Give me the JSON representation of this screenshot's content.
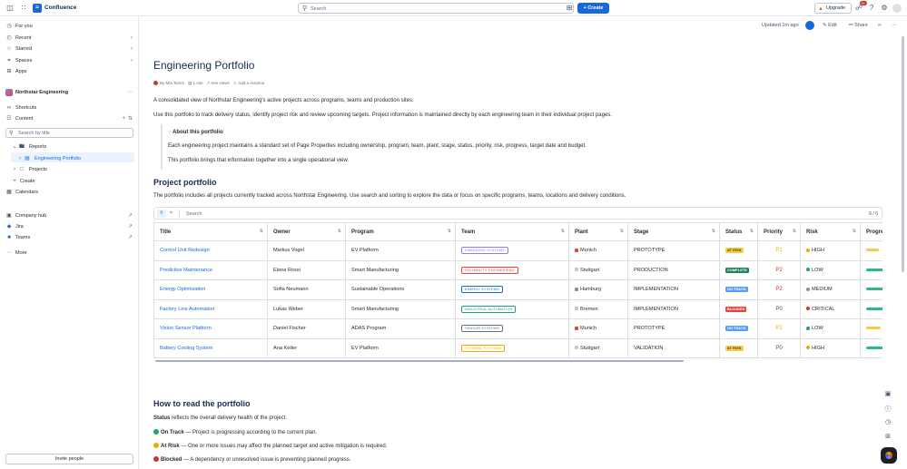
{
  "topbar": {
    "brand": "Confluence",
    "search_placeholder": "Search",
    "create_label": "Create",
    "upgrade_label": "Upgrade",
    "notif_count": "9+"
  },
  "sidebar": {
    "top_items": [
      {
        "label": "For you",
        "icon": "clock-icon"
      },
      {
        "label": "Recent",
        "icon": "recent-icon"
      },
      {
        "label": "Starred",
        "icon": "star-icon"
      },
      {
        "label": "Spaces",
        "icon": "spaces-icon"
      },
      {
        "label": "Apps",
        "icon": "apps-icon"
      }
    ],
    "space_name": "Northstar Engineering",
    "shortcuts_label": "Shortcuts",
    "content_label": "Content",
    "search_placeholder": "Search by title",
    "tree": [
      {
        "label": "Reports"
      },
      {
        "label": "Engineering Portfolio"
      },
      {
        "label": "Projects"
      },
      {
        "label": "Create"
      }
    ],
    "calendars_label": "Calendars",
    "links": [
      {
        "label": "Company hub"
      },
      {
        "label": "Jira"
      },
      {
        "label": "Teams"
      }
    ],
    "more_label": "More",
    "invite_label": "Invite people"
  },
  "page_tools": {
    "updated": "Updated 1m ago",
    "edit": "Edit",
    "share": "Share"
  },
  "page": {
    "title": "Engineering Portfolio",
    "author": "By Mia Tamm",
    "read_time": "1 min",
    "see_views": "See views",
    "add_reaction": "Add a reaction",
    "intro1": "A consolidated view of Northstar Engineering's active projects across programs, teams and production sites.",
    "intro2": "Use this portfolio to track delivery status, identify project risk and review upcoming targets. Project information is maintained directly by each engineering team in their individual project pages.",
    "callout_title": "About this portfolio",
    "callout_p1": "Each engineering project maintains a standard set of Page Properties including ownership, program, team, plant, stage, status, priority, risk, progress, target date and budget.",
    "callout_p2": "This portfolio brings that information together into a single operational view.",
    "section_title": "Project portfolio",
    "section_desc": "The portfolio includes all projects currently tracked across Northstar Engineering. Use search and sorting to explore the data or focus on specific programs, teams, locations and delivery conditions.",
    "table_search_placeholder": "Search",
    "table_count": "6 / 6",
    "how_title": "How to read the portfolio",
    "status_intro_bold": "Status",
    "status_intro_rest": " reflects the overall delivery health of the project.",
    "legend": [
      {
        "bold": "On Track",
        "rest": " — Project is progressing according to the current plan.",
        "color": "#22a06b"
      },
      {
        "bold": "At Risk",
        "rest": " — One or more issues may affect the planned target and active mitigation is required.",
        "color": "#e2b203"
      },
      {
        "bold": "Blocked",
        "rest": " — A dependency or unresolved issue is preventing planned progress.",
        "color": "#c9372c"
      }
    ]
  },
  "table": {
    "columns": [
      "Title",
      "Owner",
      "Program",
      "Team",
      "Plant",
      "Stage",
      "Status",
      "Priority",
      "Risk",
      "Progress"
    ],
    "rows": [
      {
        "title": "Control Unit Redesign",
        "owner": "Markus Vogel",
        "program": "EV Platform",
        "team": "EMBEDDED SYSTEMS",
        "team_color": "#8f7ee7",
        "plant": "Munich",
        "plant_color": "#e2483d",
        "stage": "PROTOTYPE",
        "status": "AT RISK",
        "status_bg": "#f5cd47",
        "status_fg": "#533f04",
        "priority": "P1",
        "prio_color": "#e2b203",
        "risk": "HIGH",
        "risk_color": "#e2b203",
        "progress": 0.6,
        "progress_color": "#f5cd47"
      },
      {
        "title": "Predictive Maintenance",
        "owner": "Elena Rossi",
        "program": "Smart Manufacturing",
        "team": "RELIABILITY ENGINEERING",
        "team_color": "#e2483d",
        "plant": "Stuttgart",
        "plant_color": "#c1c7d0",
        "stage": "PRODUCTION",
        "status": "COMPLETE",
        "status_bg": "#1f845a",
        "status_fg": "#ffffff",
        "priority": "P2",
        "prio_color": "#c9372c",
        "risk": "LOW",
        "risk_color": "#22a06b",
        "progress": 1.0,
        "progress_color": "#2abb7f"
      },
      {
        "title": "Energy Optimization",
        "owner": "Sofia Neumann",
        "program": "Sustainable Operations",
        "team": "ENERGY SYSTEMS",
        "team_color": "#1868db",
        "plant": "Hamburg",
        "plant_color": "#8590a2",
        "stage": "IMPLEMENTATION",
        "status": "ON TRACK",
        "status_bg": "#579dff",
        "status_fg": "#ffffff",
        "priority": "P2",
        "prio_color": "#c9372c",
        "risk": "MEDIUM",
        "risk_color": "#8590a2",
        "progress": 0.9,
        "progress_color": "#2abb7f"
      },
      {
        "title": "Factory Line Automation",
        "owner": "Lukas Weber",
        "program": "Smart Manufacturing",
        "team": "INDUSTRIAL AUTOMATION",
        "team_color": "#22a06b",
        "plant": "Bremen",
        "plant_color": "#c1c7d0",
        "stage": "IMPLEMENTATION",
        "status": "BLOCKED",
        "status_bg": "#e2483d",
        "status_fg": "#ffffff",
        "priority": "P0",
        "prio_color": "#44546f",
        "risk": "CRITICAL",
        "risk_color": "#c9372c",
        "progress": 0.85,
        "progress_color": "#2abb7f"
      },
      {
        "title": "Vision Sensor Platform",
        "owner": "Daniel Fischer",
        "program": "ADAS Program",
        "team": "SENSOR SYSTEMS",
        "team_color": "#626f86",
        "plant": "Munich",
        "plant_color": "#e2483d",
        "stage": "PROTOTYPE",
        "status": "ON TRACK",
        "status_bg": "#579dff",
        "status_fg": "#ffffff",
        "priority": "P1",
        "prio_color": "#e2b203",
        "risk": "LOW",
        "risk_color": "#22a06b",
        "progress": 0.65,
        "progress_color": "#f5cd47"
      },
      {
        "title": "Battery Cooling System",
        "owner": "Ana Keller",
        "program": "EV Platform",
        "team": "THERMAL SYSTEMS",
        "team_color": "#e2b203",
        "plant": "Stuttgart",
        "plant_color": "#c1c7d0",
        "stage": "VALIDATION",
        "status": "AT RISK",
        "status_bg": "#f5cd47",
        "status_fg": "#533f04",
        "priority": "P0",
        "prio_color": "#44546f",
        "risk": "HIGH",
        "risk_color": "#e2b203",
        "progress": 0.9,
        "progress_color": "#2abb7f"
      }
    ]
  }
}
